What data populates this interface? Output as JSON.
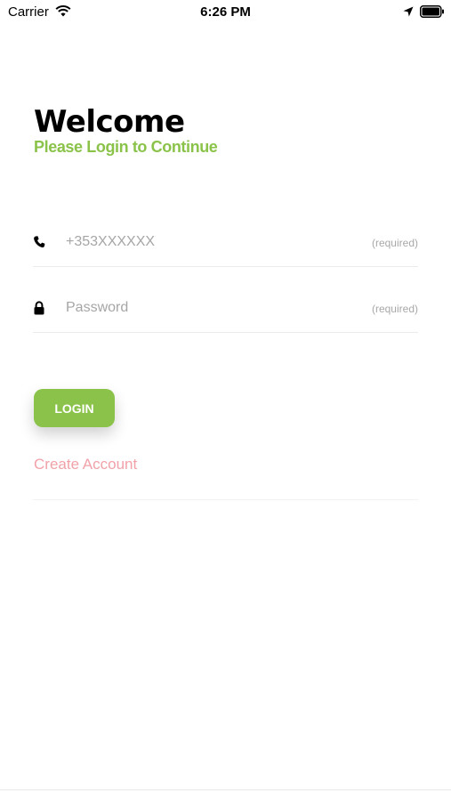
{
  "status_bar": {
    "carrier": "Carrier",
    "time": "6:26 PM",
    "icons": [
      "wifi-icon",
      "location-icon",
      "battery-icon"
    ]
  },
  "header": {
    "title": "Welcome",
    "subtitle": "Please Login to Continue"
  },
  "form": {
    "phone": {
      "icon": "phone-icon",
      "value": "",
      "placeholder": "+353XXXXXX",
      "required_label": "(required)"
    },
    "password": {
      "icon": "lock-icon",
      "value": "",
      "placeholder": "Password",
      "required_label": "(required)"
    },
    "login_label": "LOGIN",
    "create_account_label": "Create Account"
  },
  "colors": {
    "accent": "#8bc34a",
    "link": "#f1a2a8",
    "placeholder": "#a6a6a6"
  }
}
